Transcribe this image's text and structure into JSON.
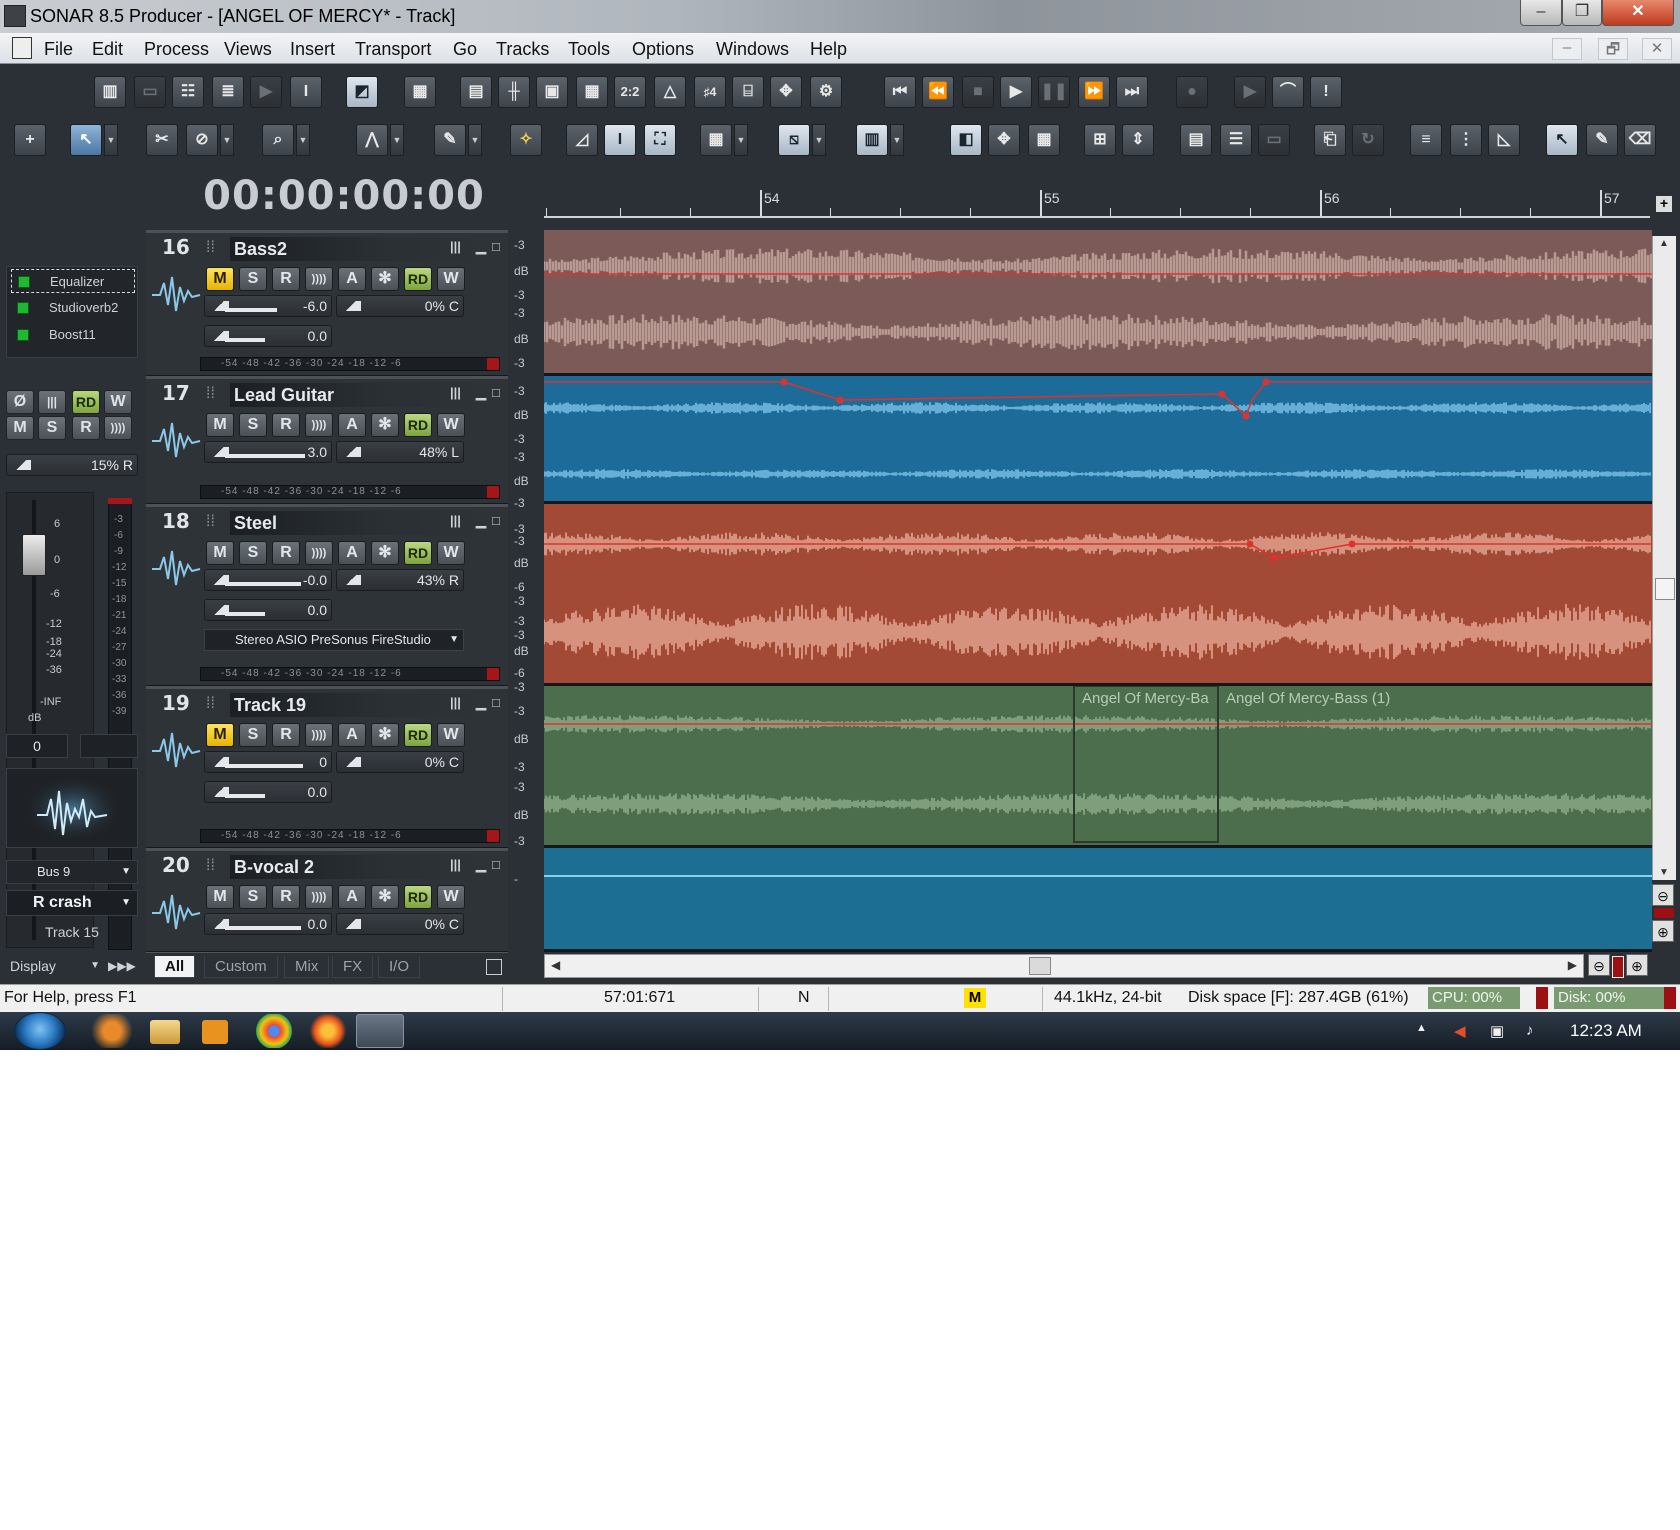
{
  "window": {
    "title": "SONAR 8.5 Producer - [ANGEL OF MERCY* - Track]",
    "controls": [
      "–",
      "❐",
      "✕"
    ],
    "mdi_controls": [
      "–",
      "🗗",
      "✕"
    ]
  },
  "menu": [
    "File",
    "Edit",
    "Process",
    "Views",
    "Insert",
    "Transport",
    "Go",
    "Tracks",
    "Tools",
    "Options",
    "Windows",
    "Help"
  ],
  "transport": {
    "time": "00:00:00:00"
  },
  "ruler": {
    "bars": [
      "54",
      "55",
      "56",
      "57"
    ]
  },
  "inspector": {
    "fx": [
      "Equalizer",
      "Studioverb2",
      "Boost11"
    ],
    "pan": "15% R",
    "fader_scale": [
      "6",
      "0",
      "-6",
      "-12",
      "-18",
      "-24",
      "-36",
      "-INF"
    ],
    "meter_scale": [
      "-3",
      "-6",
      "-9",
      "-12",
      "-15",
      "-18",
      "-21",
      "-24",
      "-27",
      "-30",
      "-33",
      "-36",
      "-39"
    ],
    "db_unit": "dB",
    "value_left": "0",
    "bus": "Bus 9",
    "instrument": "R crash",
    "track_label": "Track 15",
    "display": "Display"
  },
  "buttons": {
    "mute": "M",
    "solo": "S",
    "rec": "R",
    "input": "))))",
    "auto": "A",
    "freeze": "✻",
    "read": "RD",
    "write": "W",
    "phase": "Ø"
  },
  "meter_scale_text": "-54 -48 -42 -36 -30 -24 -18 -12 -6",
  "tracks": [
    {
      "number": "16",
      "name": "Bass2",
      "volume": "-6.0",
      "pan": "0% C",
      "trim": "0.0",
      "monitor": true,
      "color": "#7c5a57",
      "wave": "#b89a93",
      "db_labels": [
        "-3",
        "dB",
        "-3",
        "-3",
        "dB",
        "-3"
      ]
    },
    {
      "number": "17",
      "name": "Lead Guitar",
      "volume": "3.0",
      "pan": "48% L",
      "trim": "",
      "monitor": false,
      "color": "#1c6b98",
      "wave": "#7ec6ea",
      "db_labels": [
        "-3",
        "dB",
        "-3",
        "-3",
        "dB",
        "-3"
      ]
    },
    {
      "number": "18",
      "name": "Steel",
      "volume": "-0.0",
      "pan": "43% R",
      "trim": "0.0",
      "monitor": false,
      "color": "#a34a36",
      "wave": "#e8aa96",
      "output": "Stereo ASIO PreSonus FireStudio",
      "db_labels": [
        "-3",
        "-3",
        "dB",
        "-6",
        "-3",
        "-3",
        "-3",
        "dB",
        "-6",
        "-3"
      ]
    },
    {
      "number": "19",
      "name": "Track 19",
      "volume": "0",
      "pan": "0% C",
      "trim": "0.0",
      "monitor": true,
      "color": "#4c6e4c",
      "wave": "#90ae8c",
      "db_labels": [
        "-3",
        "dB",
        "-3",
        "-3",
        "dB",
        "-3"
      ]
    },
    {
      "number": "20",
      "name": "B-vocal 2",
      "volume": "0.0",
      "pan": "0% C",
      "trim": "",
      "monitor": false,
      "color": "#1c6f92",
      "wave": "#8ed0ec",
      "db_labels": [
        "-"
      ]
    }
  ],
  "clips": {
    "clip1": "Angel Of Mercy-Ba",
    "clip2": "Angel Of Mercy-Bass (1)"
  },
  "tabs": [
    "All",
    "Custom",
    "Mix",
    "FX",
    "I/O"
  ],
  "status": {
    "help": "For Help, press F1",
    "position": "57:01:671",
    "mode": "N",
    "mbadge": "M",
    "format": "44.1kHz, 24-bit",
    "disk_space": "Disk space [F]: 287.4GB (61%)",
    "cpu": "CPU: 00%",
    "disk": "Disk: 00%"
  },
  "taskbar": {
    "clock": "12:23 AM"
  }
}
